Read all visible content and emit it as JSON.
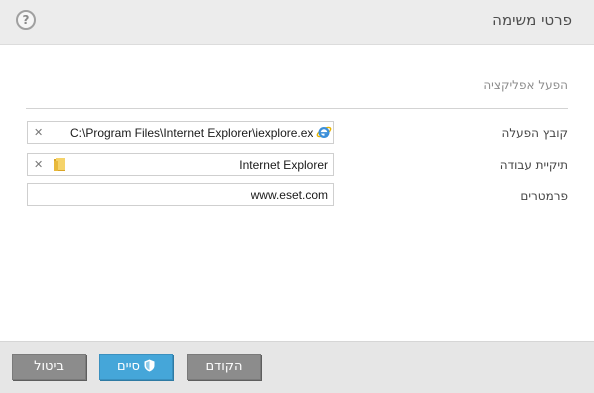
{
  "header": {
    "title": "פרטי משימה",
    "help_label": "?"
  },
  "section": {
    "title": "הפעל אפליקציה"
  },
  "fields": {
    "executable": {
      "label": "קובץ הפעלה",
      "value": "C:\\Program Files\\Internet Explorer\\iexplore.exe",
      "icon": "internet-explorer-icon"
    },
    "working_dir": {
      "label": "תיקיית עבודה",
      "value": "Internet Explorer",
      "icon": "folder-icon"
    },
    "parameters": {
      "label": "פרמטרים",
      "value": "www.eset.com"
    }
  },
  "footer": {
    "back_label": "הקודם",
    "finish_label": "סיים",
    "cancel_label": "ביטול"
  },
  "colors": {
    "accent": "#45a6d9",
    "grey_button": "#8c8c8c",
    "header_bg": "#ececec"
  }
}
